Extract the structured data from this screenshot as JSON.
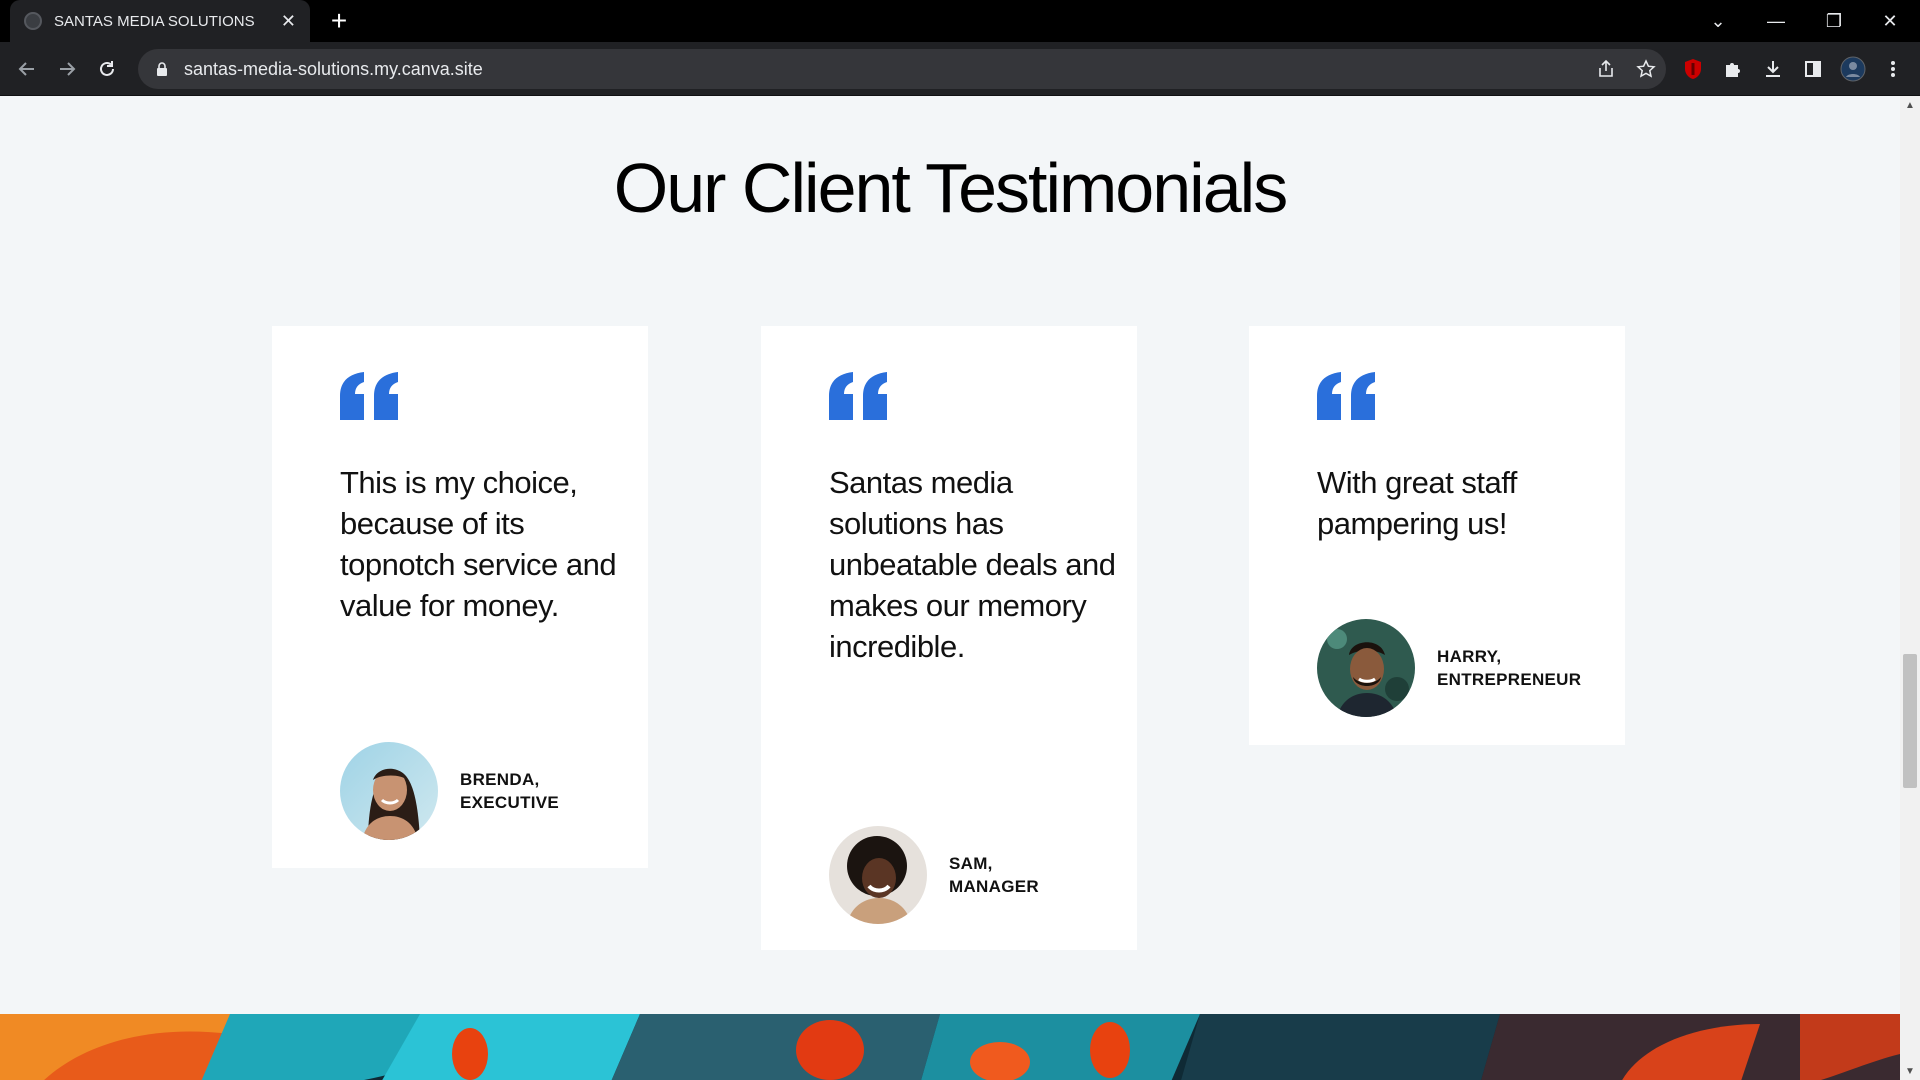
{
  "browser": {
    "tab_title": "SANTAS MEDIA SOLUTIONS",
    "tab_close": "✕",
    "new_tab": "+",
    "url": "santas-media-solutions.my.canva.site",
    "window_controls": {
      "tab_search": "⌄",
      "minimize": "—",
      "restore": "❐",
      "close": "✕"
    }
  },
  "section": {
    "title": "Our Client Testimonials"
  },
  "testimonials": [
    {
      "quote": "This is my choice, because of its topnotch service and value for money.",
      "name": "BRENDA,",
      "role": "EXECUTIVE"
    },
    {
      "quote": "Santas media solutions has unbeatable deals and makes our memory incredible.",
      "name": "SAM,",
      "role": "MANAGER"
    },
    {
      "quote": "With great staff pampering us!",
      "name": "HARRY,",
      "role": "ENTREPRENEUR"
    }
  ],
  "colors": {
    "accent": "#2a6fdb",
    "page_background": "#f3f6f8",
    "card_background": "#ffffff"
  }
}
